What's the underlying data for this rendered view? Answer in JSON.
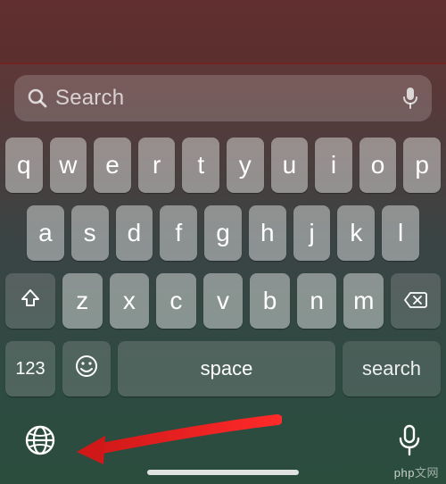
{
  "search": {
    "placeholder": "Search"
  },
  "keyboard": {
    "row1": [
      "q",
      "w",
      "e",
      "r",
      "t",
      "y",
      "u",
      "i",
      "o",
      "p"
    ],
    "row2": [
      "a",
      "s",
      "d",
      "f",
      "g",
      "h",
      "j",
      "k",
      "l"
    ],
    "row3": [
      "z",
      "x",
      "c",
      "v",
      "b",
      "n",
      "m"
    ],
    "numbers_label": "123",
    "space_label": "space",
    "search_label": "search"
  },
  "watermark": {
    "text_a": "php",
    "text_b": "文网"
  }
}
